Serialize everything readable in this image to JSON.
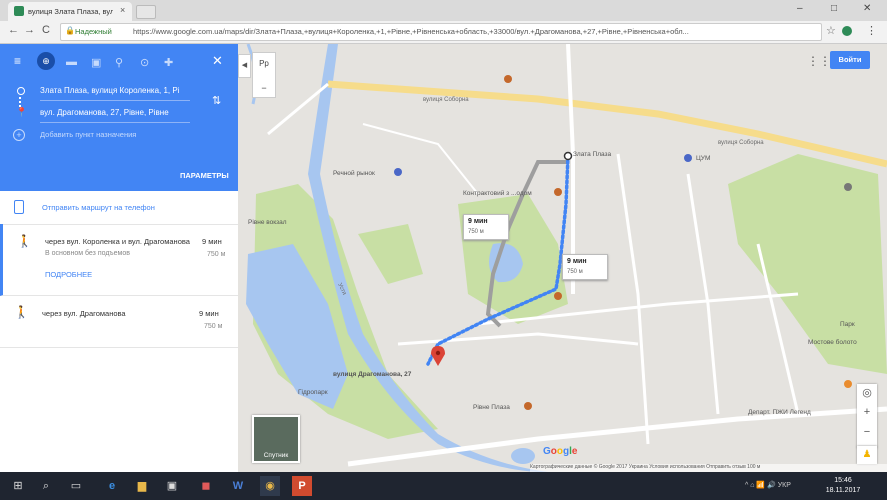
{
  "browser": {
    "tab_title": "вулиця Злата Плаза, вул...",
    "tab_close": "×",
    "new_tab": "",
    "win_min": "–",
    "win_max": "□",
    "win_close": "✕",
    "nav_back": "←",
    "nav_forward": "→",
    "nav_reload": "C",
    "secure_label": "Надежный",
    "url": "https://www.google.com.ua/maps/dir/Злата+Плаза,+вулиця+Короленка,+1,+Рівне,+Рівненська+область,+33000/вул.+Драгоманова,+27,+Рівне,+Рівненська+обл...",
    "star": "☆",
    "menu": "⋮"
  },
  "panel": {
    "modes": [
      "≡",
      "⊕",
      "🚗",
      "▣",
      "🚶",
      "♦",
      "✈"
    ],
    "close": "✕",
    "origin": "Злата Плаза, вулиця Короленка, 1, Рі",
    "destination": "вул. Драгоманова, 27, Рівне, Рівне",
    "swap": "⇅",
    "add_plus": "+",
    "add_destination": "Добавить пункт назначения",
    "params_label": "ПАРАМЕТРЫ",
    "send_to_phone": "Отправить маршрут на телефон",
    "routes": [
      {
        "via": "через вул. Короленка и вул. Драгоманова",
        "time": "9 мин",
        "dist": "750 м",
        "sub": "В основном без подъемов",
        "details": "ПОДРОБНЕЕ"
      },
      {
        "via": "через вул. Драгоманова",
        "time": "9 мин",
        "dist": "750 м"
      }
    ]
  },
  "map": {
    "collapse": "◀",
    "lang": "Рр",
    "lang_minus": "−",
    "apps_icon": "⋮⋮⋮",
    "signin": "Войти",
    "satellite_label": "Спутник",
    "zoom_in": "+",
    "zoom_out": "−",
    "pegman": "●",
    "google": "Google",
    "footer": "Картографические данные © Google 2017   Украина   Условия использования   Отправить отзыв   100 м",
    "labels": {
      "zlata": "Злата Плаза",
      "tsum": "ЦУМ",
      "rynok": "Речной рынок",
      "vulytsia_soborna": "вулиця Соборна",
      "vulytsia_soborna2": "вулиця Соборна",
      "kontraktova": "Контрактовий з ...одом",
      "hidropark": "Гідропарк",
      "ustia": "Устя",
      "vokzal": "Рівне вокзал",
      "park": "Парк",
      "mostove": "Мостове болото",
      "dragomanova_dest": "вулиця Драгоманова, 27",
      "rivne_plaza": "Рівне Плаза",
      "depart": "Департ. ПЖИ Легенд"
    },
    "callouts": [
      {
        "time": "9 мин",
        "dist": "750 м"
      },
      {
        "time": "9 мин",
        "dist": "750 м"
      }
    ]
  },
  "taskbar": {
    "start": "⊞",
    "search": "⌕",
    "taskview": "▭",
    "apps": [
      "e",
      "📁",
      "🛍",
      "✉",
      "W",
      "◉",
      "P"
    ],
    "tray": "^  ⌂  📶  🔊  УКР",
    "time": "15:46",
    "date": "18.11.2017"
  }
}
